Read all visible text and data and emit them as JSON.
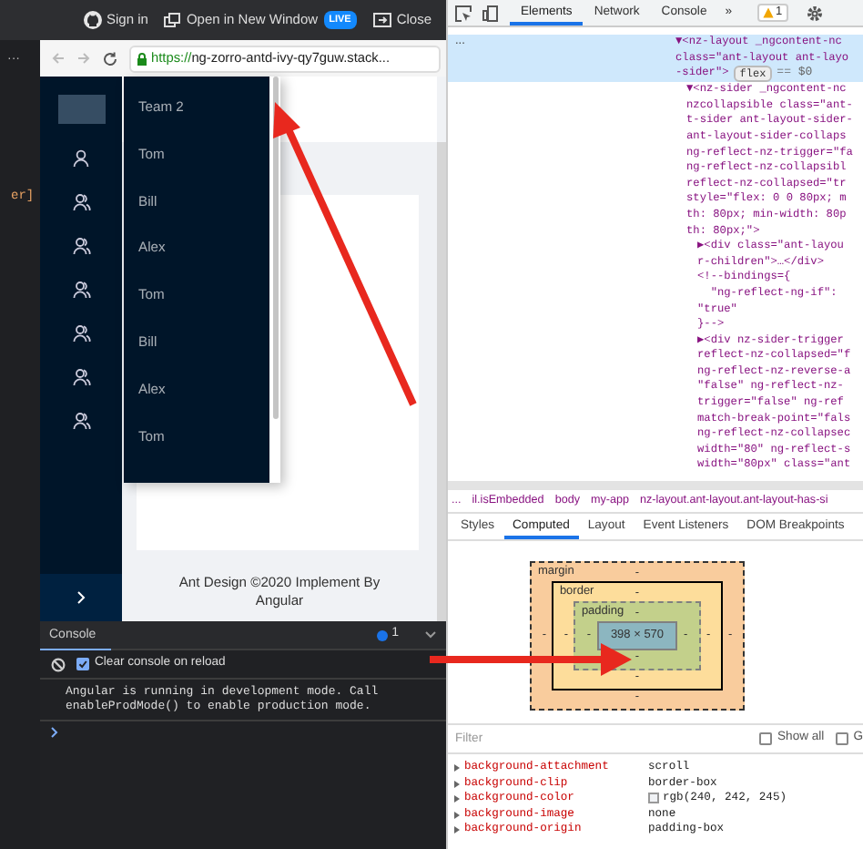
{
  "stackblitz_bar": {
    "sign_in": "Sign in",
    "open_in_new_window": "Open in New Window",
    "live_badge": "LIVE",
    "close": "Close"
  },
  "editor": {
    "more": "···",
    "code_fragment": "er]"
  },
  "browser": {
    "url_scheme": "https://",
    "url_rest": "ng-zorro-antd-ivy-qy7guw.stack..."
  },
  "app": {
    "sider_icons": [
      {
        "kind": "user"
      },
      {
        "kind": "team"
      },
      {
        "kind": "team"
      },
      {
        "kind": "team"
      },
      {
        "kind": "team"
      },
      {
        "kind": "team"
      },
      {
        "kind": "team"
      }
    ],
    "popup_menu": [
      {
        "label": "Team 2"
      },
      {
        "label": "Tom"
      },
      {
        "label": "Bill"
      },
      {
        "label": "Alex"
      },
      {
        "label": "Tom"
      },
      {
        "label": "Bill"
      },
      {
        "label": "Alex"
      },
      {
        "label": "Tom"
      }
    ],
    "footer": "Ant Design ©2020 Implement By Angular"
  },
  "console": {
    "tab": "Console",
    "info_count": "1",
    "clear_on_reload": {
      "label": "Clear console on reload",
      "checked": true
    },
    "message_lines": [
      "Angular is running in development mode. Call",
      "enableProdMode() to enable production mode."
    ]
  },
  "devtools": {
    "tabs": [
      {
        "label": "Elements",
        "selected": true
      },
      {
        "label": "Network",
        "selected": false
      },
      {
        "label": "Console",
        "selected": false
      }
    ],
    "overflow": "»",
    "warning_count": "1",
    "dom_tree": [
      {
        "selected": true,
        "marker": "...",
        "lines": [
          "▼<nz-layout _ngcontent-nc",
          "class=\"ant-layout ant-layo",
          "-sider\">"
        ],
        "badge": "flex",
        "suffix": "== $0",
        "children": [
          {
            "selected": false,
            "lines": [
              "▼<nz-sider _ngcontent-nc",
              "nzcollapsible class=\"ant-",
              "t-sider ant-layout-sider-",
              "ant-layout-sider-collaps",
              "ng-reflect-nz-trigger=\"fa",
              "ng-reflect-nz-collapsibl",
              "reflect-nz-collapsed=\"tr",
              "style=\"flex: 0 0 80px; m",
              "th: 80px; min-width: 80p",
              "th: 80px;\">"
            ],
            "children": [
              {
                "selected": false,
                "lines": [
                  "▶<div class=\"ant-layou",
                  "r-children\">…</div>"
                ]
              },
              {
                "selected": false,
                "lines": [
                  "<!--bindings={",
                  "  \"ng-reflect-ng-if\":",
                  "\"true\"",
                  "}-->"
                ]
              },
              {
                "selected": false,
                "lines": [
                  "▶<div nz-sider-trigger",
                  "reflect-nz-collapsed=\"f",
                  "ng-reflect-nz-reverse-a",
                  "\"false\" ng-reflect-nz-",
                  "trigger=\"false\" ng-ref",
                  "match-break-point=\"fals",
                  "ng-reflect-nz-collapsec",
                  "width=\"80\" ng-reflect-s",
                  "width=\"80px\" class=\"ant"
                ]
              }
            ]
          }
        ]
      }
    ],
    "breadcrumbs": [
      "...",
      "il.isEmbedded",
      "body",
      "my-app",
      "nz-layout.ant-layout.ant-layout-has-si"
    ],
    "pane_tabs": [
      {
        "label": "Styles",
        "selected": false
      },
      {
        "label": "Computed",
        "selected": true
      },
      {
        "label": "Layout",
        "selected": false
      },
      {
        "label": "Event Listeners",
        "selected": false
      },
      {
        "label": "DOM Breakpoints",
        "selected": false
      }
    ],
    "box_model": {
      "margin": {
        "label": "margin",
        "top": "-",
        "right": "-",
        "bottom": "-",
        "left": "-"
      },
      "border": {
        "label": "border",
        "top": "-",
        "right": "-",
        "bottom": "-",
        "left": "-"
      },
      "padding": {
        "label": "padding",
        "top": "-",
        "right": "-",
        "bottom": "-",
        "left": "-"
      },
      "content": "398 × 570"
    },
    "filter": {
      "placeholder": "Filter"
    },
    "filter_options": [
      {
        "label": "Show all",
        "checked": false
      },
      {
        "label": "G",
        "checked": false
      }
    ],
    "properties": [
      {
        "name": "background-attachment",
        "value": "scroll"
      },
      {
        "name": "background-clip",
        "value": "border-box"
      },
      {
        "name": "background-color",
        "value": "rgb(240, 242, 245)",
        "color": "#f0f2f5"
      },
      {
        "name": "background-image",
        "value": "none"
      },
      {
        "name": "background-origin",
        "value": "padding-box"
      }
    ]
  }
}
